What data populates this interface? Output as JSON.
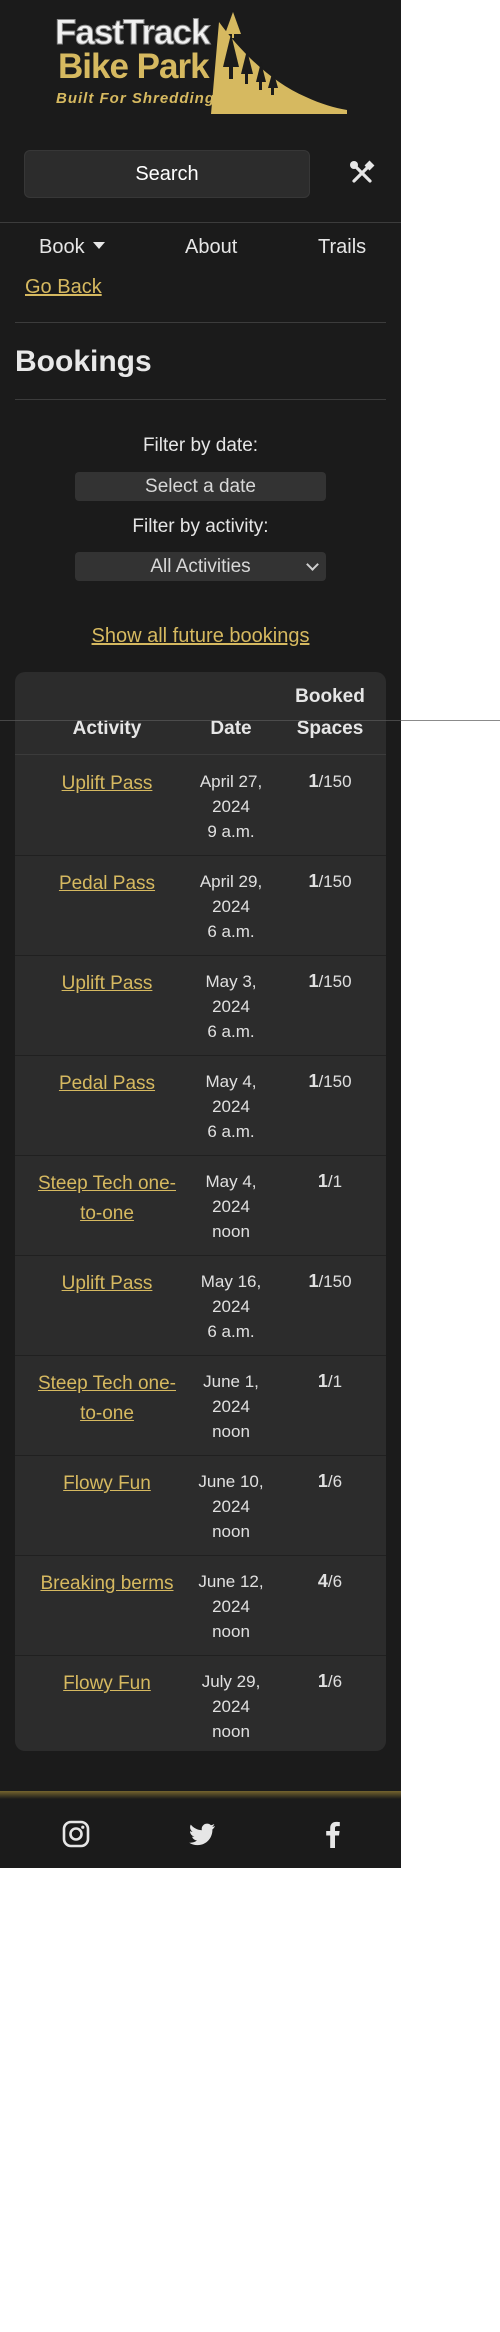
{
  "brand": {
    "line1": "FastTrack",
    "line2": "Bike Park",
    "tagline": "Built For Shredding",
    "accent": "#d6b960"
  },
  "search": {
    "label": "Search"
  },
  "toolbar": {
    "settings_icon": "tools-icon"
  },
  "nav": {
    "items": [
      {
        "label": "Book",
        "has_dropdown": true
      },
      {
        "label": "About"
      },
      {
        "label": "Trails"
      }
    ]
  },
  "back_link": "Go Back",
  "page_title": "Bookings",
  "filters": {
    "date_label": "Filter by date:",
    "date_placeholder": "Select a date",
    "activity_label": "Filter by activity:",
    "activity_selected": "All Activities"
  },
  "show_all": "Show all future bookings",
  "table": {
    "headers": {
      "activity": "Activity",
      "date": "Date",
      "booked_line1": "Booked",
      "booked_line2": "Spaces"
    },
    "rows": [
      {
        "activity": "Uplift Pass",
        "date": [
          "April 27,",
          "2024",
          "9 a.m."
        ],
        "booked": "1",
        "total": "/150"
      },
      {
        "activity": "Pedal Pass",
        "date": [
          "April 29,",
          "2024",
          "6 a.m."
        ],
        "booked": "1",
        "total": "/150"
      },
      {
        "activity": "Uplift Pass",
        "date": [
          "May 3,",
          "2024",
          "6 a.m."
        ],
        "booked": "1",
        "total": "/150"
      },
      {
        "activity": "Pedal Pass",
        "date": [
          "May 4,",
          "2024",
          "6 a.m."
        ],
        "booked": "1",
        "total": "/150"
      },
      {
        "activity": "Steep Tech one-to-one",
        "date": [
          "May 4,",
          "2024",
          "noon"
        ],
        "booked": "1",
        "total": "/1"
      },
      {
        "activity": "Uplift Pass",
        "date": [
          "May 16,",
          "2024",
          "6 a.m."
        ],
        "booked": "1",
        "total": "/150"
      },
      {
        "activity": "Steep Tech one-to-one",
        "date": [
          "June 1,",
          "2024",
          "noon"
        ],
        "booked": "1",
        "total": "/1"
      },
      {
        "activity": "Flowy Fun",
        "date": [
          "June 10,",
          "2024",
          "noon"
        ],
        "booked": "1",
        "total": "/6"
      },
      {
        "activity": "Breaking berms",
        "date": [
          "June 12,",
          "2024",
          "noon"
        ],
        "booked": "4",
        "total": "/6"
      },
      {
        "activity": "Flowy Fun",
        "date": [
          "July 29,",
          "2024",
          "noon"
        ],
        "booked": "1",
        "total": "/6"
      }
    ]
  },
  "footer": {
    "icons": [
      "instagram-icon",
      "twitter-icon",
      "facebook-icon"
    ]
  }
}
